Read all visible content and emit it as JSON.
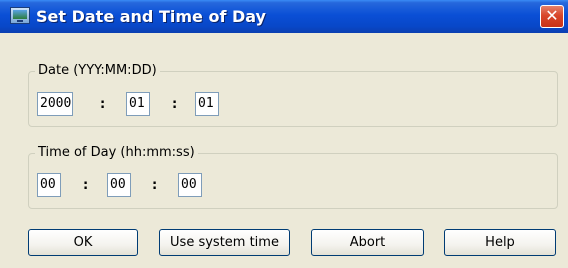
{
  "window": {
    "title": "Set Date and Time of Day",
    "close_glyph": "✕"
  },
  "date_group": {
    "legend": "Date (YYY:MM:DD)",
    "year": "2000",
    "month": "01",
    "day": "01",
    "separator": ":"
  },
  "time_group": {
    "legend": "Time of Day (hh:mm:ss)",
    "hours": "00",
    "minutes": "00",
    "seconds": "00",
    "separator": ":"
  },
  "buttons": {
    "ok": "OK",
    "use_system_time": "Use system time",
    "abort": "Abort",
    "help": "Help"
  },
  "colors": {
    "titlebar": "#0a4fd6",
    "window_bg": "#ece9d8",
    "close_button": "#d9462a",
    "field_border": "#7f9db9"
  }
}
